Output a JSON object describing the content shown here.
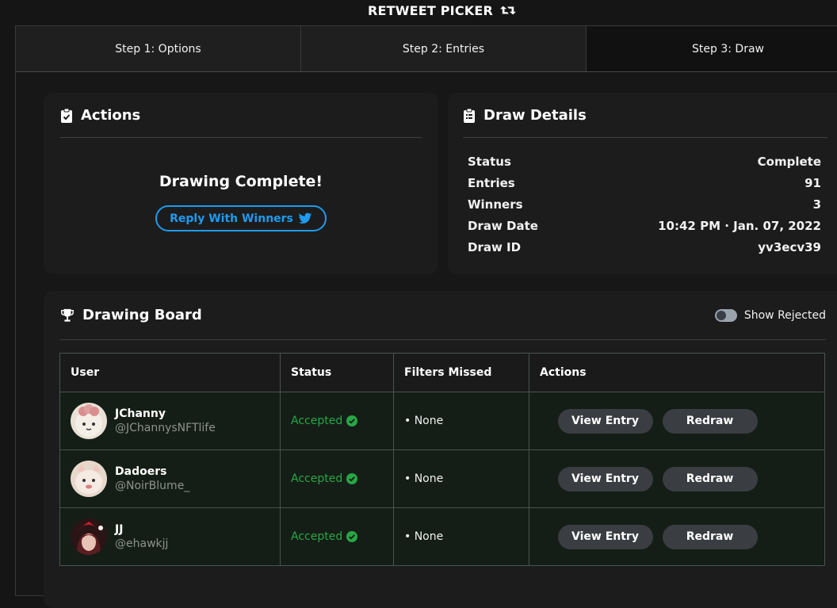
{
  "app": {
    "title": "RETWEET PICKER"
  },
  "tabs": [
    {
      "label": "Step 1: Options"
    },
    {
      "label": "Step 2: Entries"
    },
    {
      "label": "Step 3: Draw",
      "active": true
    }
  ],
  "actions": {
    "title": "Actions",
    "complete_message": "Drawing Complete!",
    "reply_button": "Reply With Winners"
  },
  "details": {
    "title": "Draw Details",
    "rows": [
      {
        "label": "Status",
        "value": "Complete"
      },
      {
        "label": "Entries",
        "value": "91"
      },
      {
        "label": "Winners",
        "value": "3"
      },
      {
        "label": "Draw Date",
        "value": "10:42 PM · Jan. 07, 2022"
      },
      {
        "label": "Draw ID",
        "value": "yv3ecv39"
      }
    ]
  },
  "board": {
    "title": "Drawing Board",
    "toggle_label": "Show Rejected",
    "toggle_on": false,
    "columns": [
      "User",
      "Status",
      "Filters Missed",
      "Actions"
    ],
    "rows": [
      {
        "name": "JChanny",
        "handle": "@JChannysNFTlife",
        "status": "Accepted",
        "filters": "• None",
        "view_label": "View Entry",
        "redraw_label": "Redraw"
      },
      {
        "name": "Dadoers",
        "handle": "@NoirBlume_",
        "status": "Accepted",
        "filters": "• None",
        "view_label": "View Entry",
        "redraw_label": "Redraw"
      },
      {
        "name": "JJ",
        "handle": "@ehawkjj",
        "status": "Accepted",
        "filters": "• None",
        "view_label": "View Entry",
        "redraw_label": "Redraw"
      }
    ]
  },
  "colors": {
    "accent_blue": "#1d9bf0",
    "accepted_green": "#28a745",
    "background": "#151516",
    "card": "#1c1c1d"
  },
  "icons": {
    "title": "retweet-icon",
    "actions": "clipboard-check-icon",
    "details": "clipboard-list-icon",
    "board": "trophy-icon",
    "reply": "twitter-bird-icon",
    "accepted": "check-circle-icon"
  }
}
